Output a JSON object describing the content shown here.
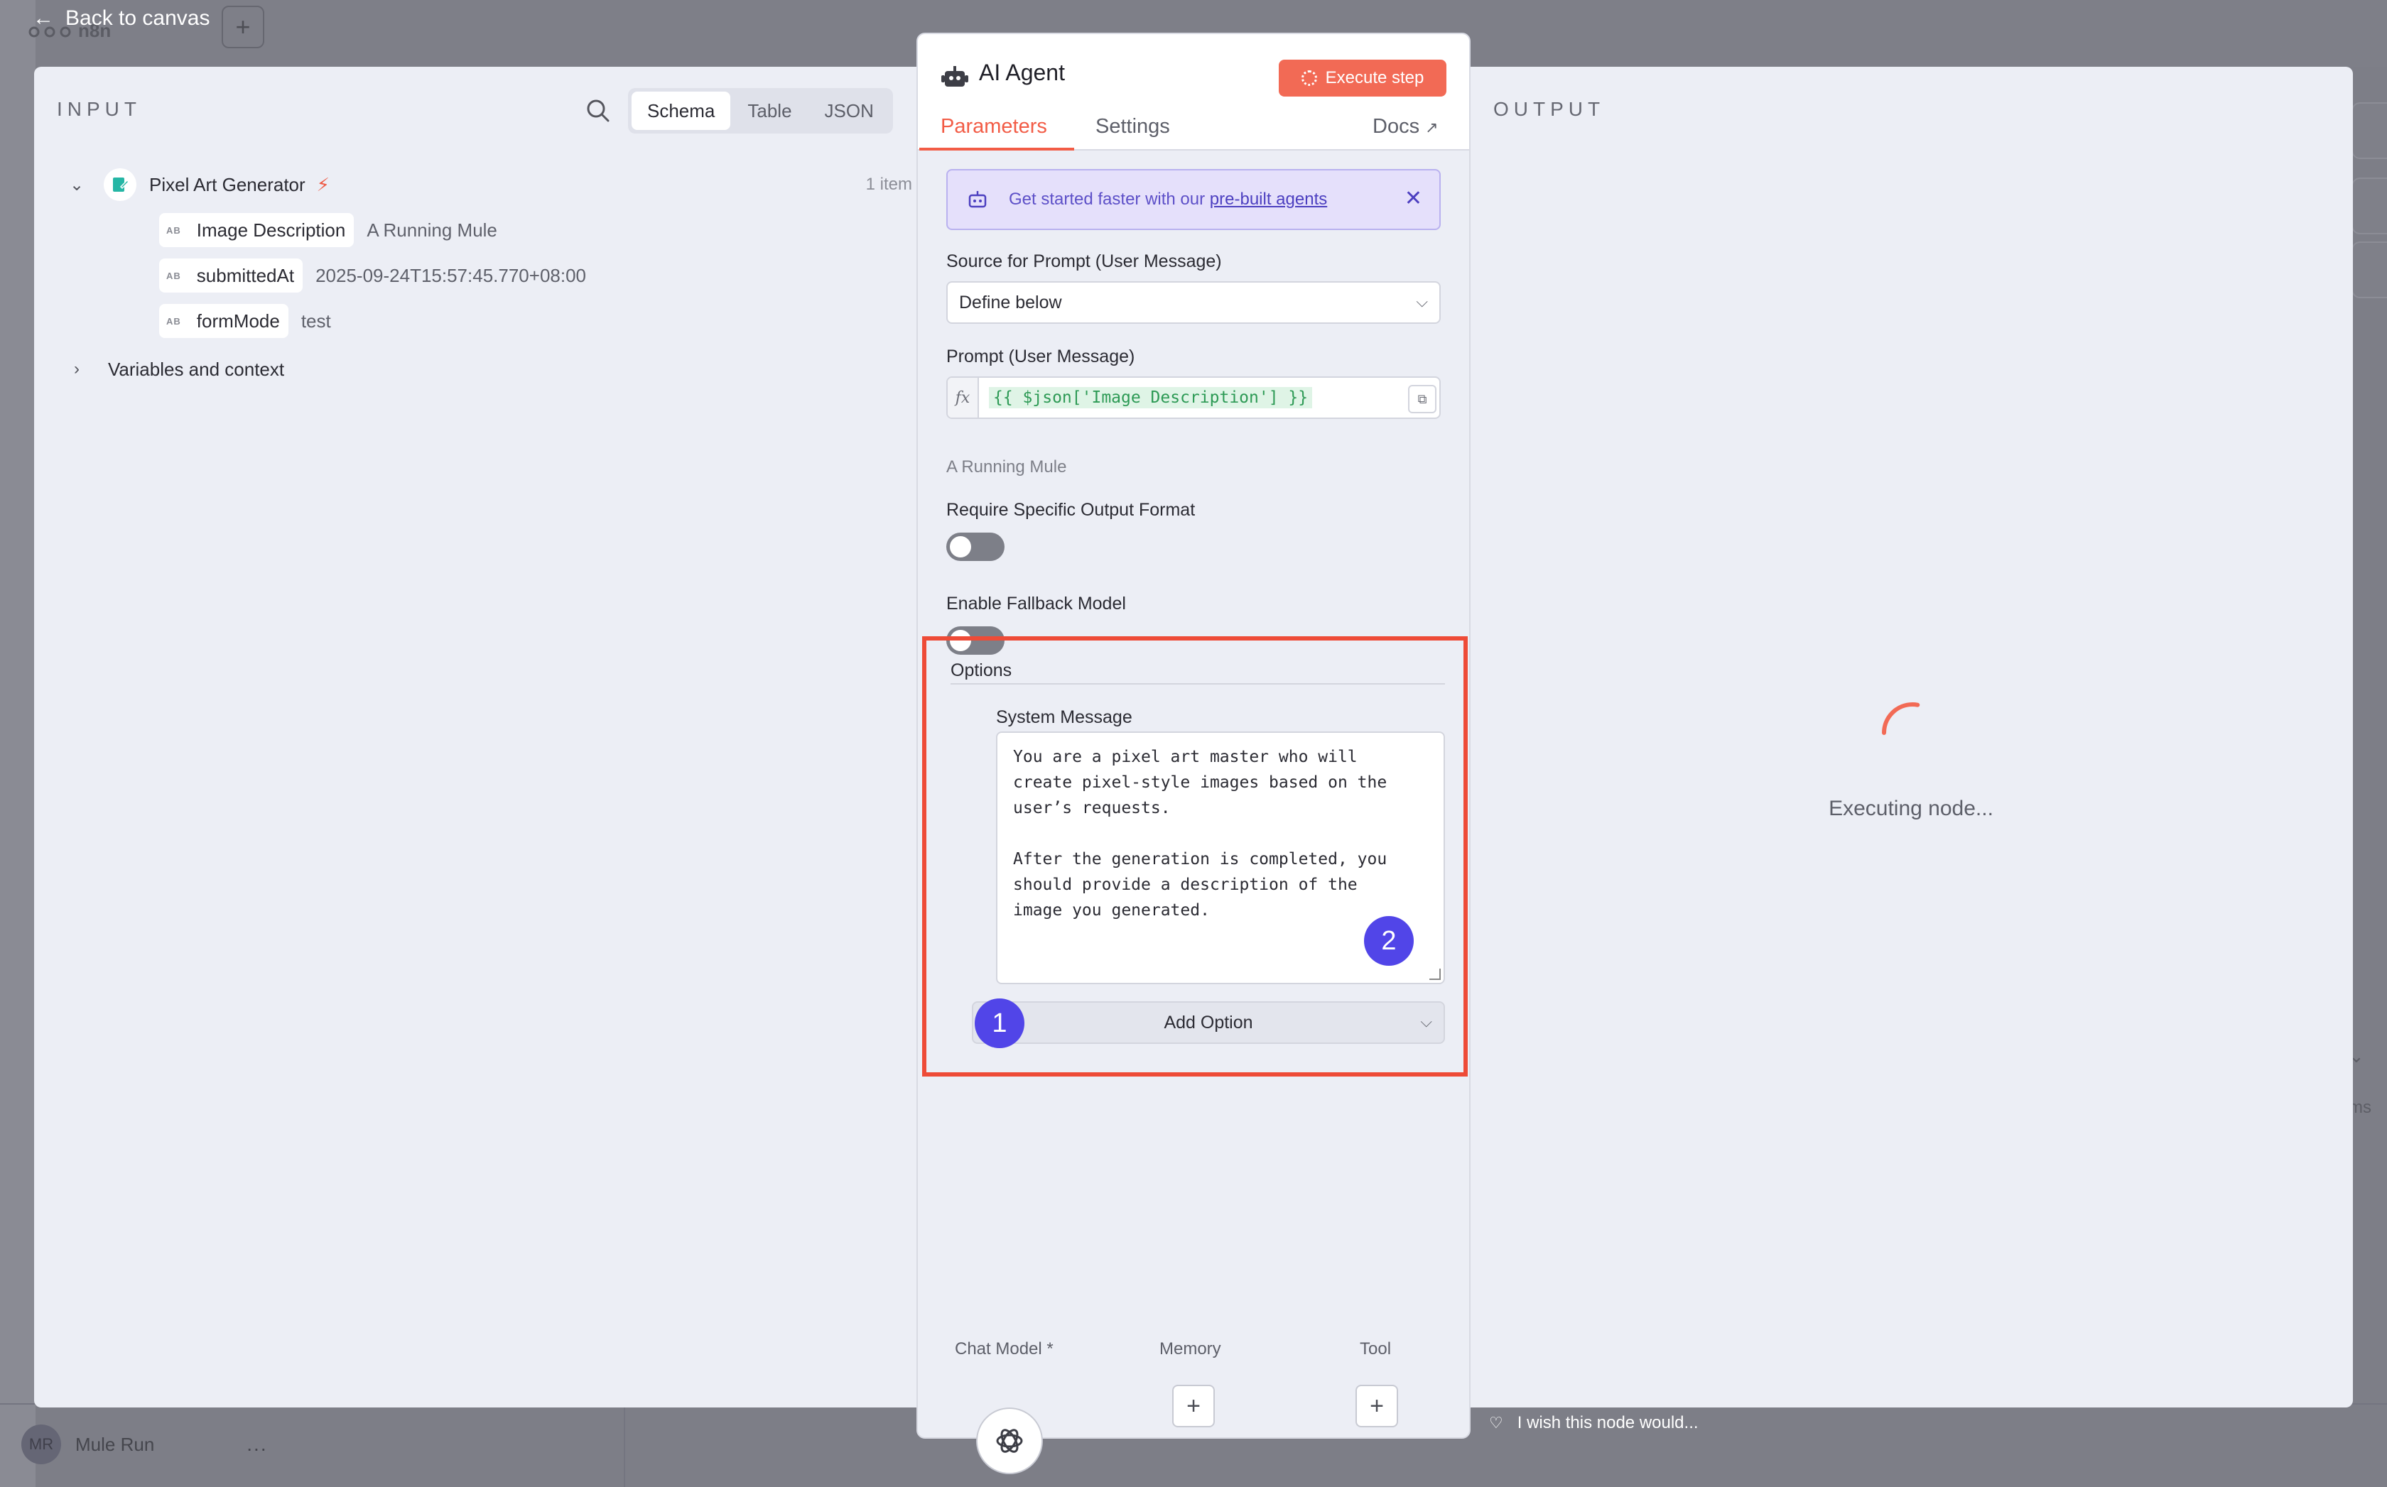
{
  "app": {
    "logo_text": "n8n",
    "back_label": "Back to canvas",
    "user_initials": "MR",
    "user_name": "Mule Run",
    "more": "..."
  },
  "input": {
    "label": "INPUT",
    "views": [
      "Schema",
      "Table",
      "JSON"
    ],
    "active_view": "Schema",
    "node_name": "Pixel Art Generator",
    "item_count": "1 item",
    "fields": [
      {
        "type": "AB",
        "name": "Image Description",
        "value": "A Running Mule"
      },
      {
        "type": "AB",
        "name": "submittedAt",
        "value": "2025-09-24T15:57:45.770+08:00"
      },
      {
        "type": "AB",
        "name": "formMode",
        "value": "test"
      }
    ],
    "variables_label": "Variables and context"
  },
  "output": {
    "label": "OUTPUT",
    "status": "Executing node..."
  },
  "node": {
    "title": "AI Agent",
    "execute_label": "Execute step",
    "tabs": {
      "parameters": "Parameters",
      "settings": "Settings",
      "docs": "Docs"
    },
    "banner": {
      "text": "Get started faster with our ",
      "link": "pre-built agents"
    },
    "source_label": "Source for Prompt (User Message)",
    "source_value": "Define below",
    "prompt_label": "Prompt (User Message)",
    "prompt_expr": "{{ $json['Image Description'] }}",
    "prompt_preview": "A Running Mule",
    "require_format_label": "Require Specific Output Format",
    "require_format_on": false,
    "fallback_label": "Enable Fallback Model",
    "fallback_on": false,
    "options_label": "Options",
    "system_message_label": "System Message",
    "system_message": "You are a pixel art master who will\ncreate pixel-style images based on the\nuser’s requests.\n\nAfter the generation is completed, you\nshould provide a description of the\nimage you generated.",
    "add_option_label": "Add Option",
    "badge_1": "1",
    "badge_2": "2",
    "sub_nodes": {
      "chat_model": "Chat Model *",
      "memory": "Memory",
      "tool": "Tool"
    }
  },
  "feedback": "I wish this node would...",
  "colors": {
    "accent": "#f25c46",
    "highlight": "#ee4b37",
    "badge": "#5145e8"
  }
}
